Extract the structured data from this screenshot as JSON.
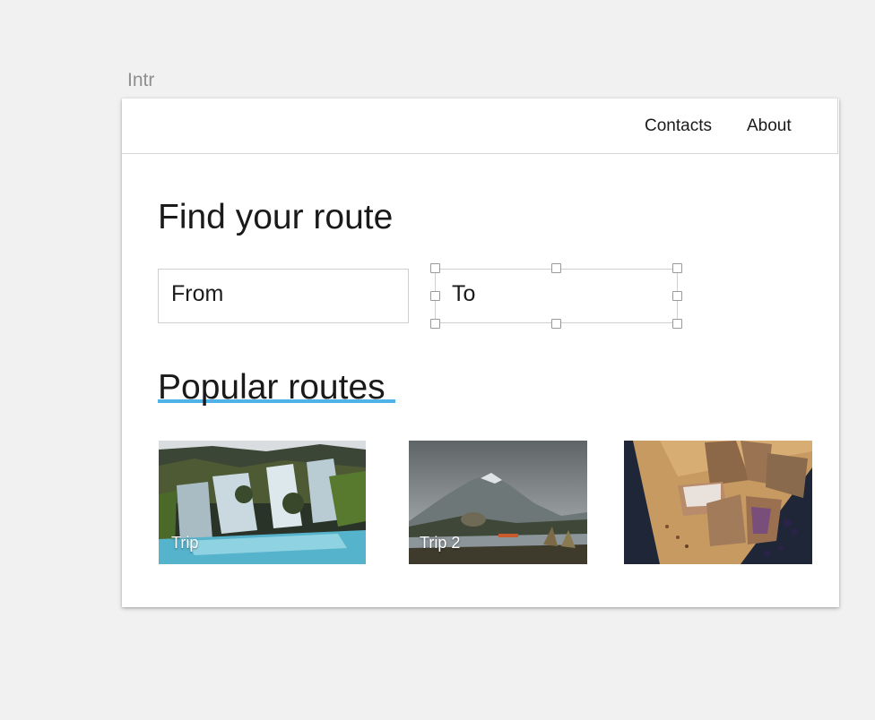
{
  "canvas": {
    "frame_label": "Intr"
  },
  "nav": {
    "items": [
      {
        "label": "Contacts"
      },
      {
        "label": "About"
      }
    ]
  },
  "main": {
    "title": "Find your route",
    "from_field": {
      "value": "From"
    },
    "to_field": {
      "value": "To"
    },
    "popular": {
      "title": "Popular routes",
      "underline_color": "#4fb3e8",
      "cards": [
        {
          "label": "Trip",
          "image": "waterfall-photo"
        },
        {
          "label": "Trip 2",
          "image": "mountain-lake-photo"
        },
        {
          "label": "",
          "image": "baked-goods-photo"
        }
      ]
    }
  }
}
